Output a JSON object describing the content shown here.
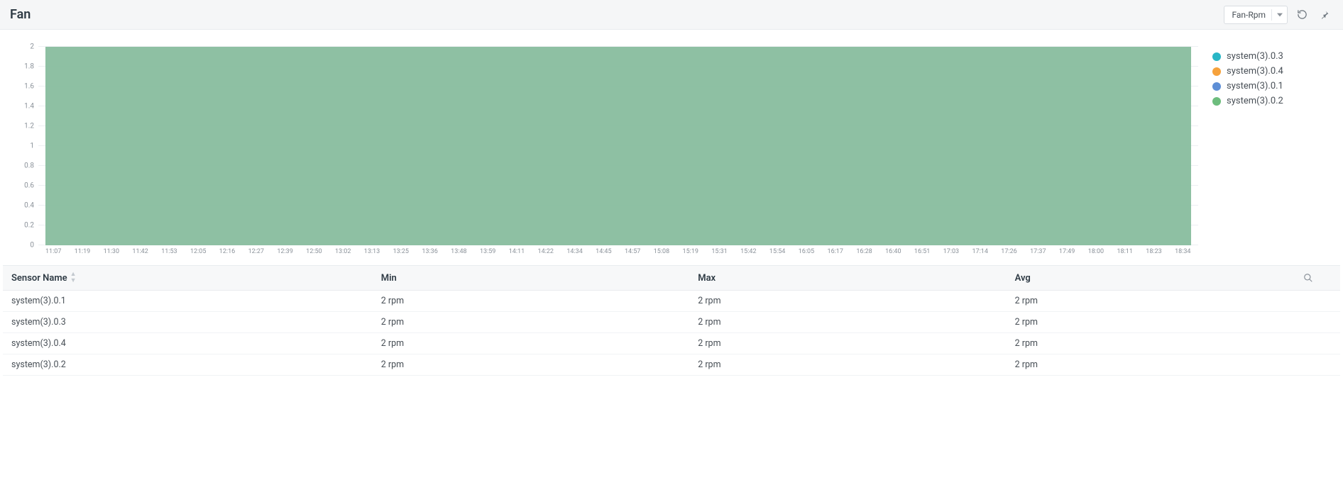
{
  "header": {
    "title": "Fan",
    "dropdown_label": "Fan-Rpm"
  },
  "legend": [
    {
      "label": "system(3).0.3",
      "color": "#29b6c6"
    },
    {
      "label": "system(3).0.4",
      "color": "#f6a23c"
    },
    {
      "label": "system(3).0.1",
      "color": "#5e8fd6"
    },
    {
      "label": "system(3).0.2",
      "color": "#6dbd7d"
    }
  ],
  "table": {
    "columns": {
      "sensor": "Sensor Name",
      "min": "Min",
      "max": "Max",
      "avg": "Avg"
    },
    "rows": [
      {
        "name": "system(3).0.1",
        "min": "2 rpm",
        "max": "2 rpm",
        "avg": "2 rpm"
      },
      {
        "name": "system(3).0.3",
        "min": "2 rpm",
        "max": "2 rpm",
        "avg": "2 rpm"
      },
      {
        "name": "system(3).0.4",
        "min": "2 rpm",
        "max": "2 rpm",
        "avg": "2 rpm"
      },
      {
        "name": "system(3).0.2",
        "min": "2 rpm",
        "max": "2 rpm",
        "avg": "2 rpm"
      }
    ]
  },
  "chart_data": {
    "type": "area",
    "title": "Fan",
    "ylabel": "",
    "xlabel": "",
    "ylim": [
      0,
      2
    ],
    "y_ticks": [
      0,
      0.2,
      0.4,
      0.6,
      0.8,
      1,
      1.2,
      1.4,
      1.6,
      1.8,
      2
    ],
    "x_ticks": [
      "11:07",
      "11:19",
      "11:30",
      "11:42",
      "11:53",
      "12:05",
      "12:16",
      "12:27",
      "12:39",
      "12:50",
      "13:02",
      "13:13",
      "13:25",
      "13:36",
      "13:48",
      "13:59",
      "14:11",
      "14:22",
      "14:34",
      "14:45",
      "14:57",
      "15:08",
      "15:19",
      "15:31",
      "15:42",
      "15:54",
      "16:05",
      "16:17",
      "16:28",
      "16:40",
      "16:51",
      "17:03",
      "17:14",
      "17:26",
      "17:37",
      "17:49",
      "18:00",
      "18:11",
      "18:23",
      "18:34"
    ],
    "series": [
      {
        "name": "system(3).0.3",
        "color": "#29b6c6",
        "constant_value": 2
      },
      {
        "name": "system(3).0.4",
        "color": "#f6a23c",
        "constant_value": 2
      },
      {
        "name": "system(3).0.1",
        "color": "#5e8fd6",
        "constant_value": 2
      },
      {
        "name": "system(3).0.2",
        "color": "#6dbd7d",
        "constant_value": 2
      }
    ],
    "area_color": "#88bd9e"
  }
}
